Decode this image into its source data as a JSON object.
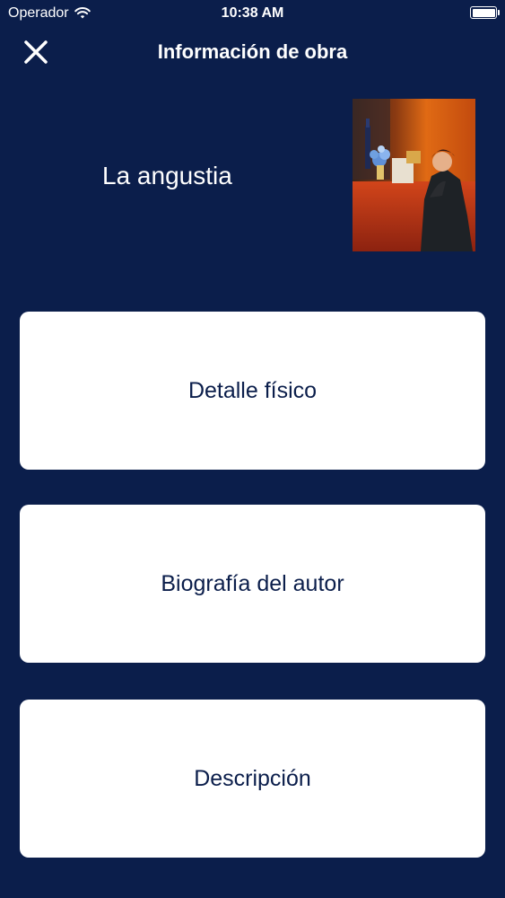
{
  "status_bar": {
    "carrier": "Operador",
    "time": "10:38 AM",
    "battery_level": 1.0
  },
  "header": {
    "title": "Información de obra",
    "close_icon": "close-icon"
  },
  "artwork": {
    "title": "La angustia"
  },
  "menu": {
    "items": [
      {
        "label": "Detalle físico"
      },
      {
        "label": "Biografía del autor"
      },
      {
        "label": "Descripción"
      }
    ]
  },
  "colors": {
    "background": "#0b1e4b",
    "card": "#ffffff",
    "card_text": "#0b1e4b"
  }
}
